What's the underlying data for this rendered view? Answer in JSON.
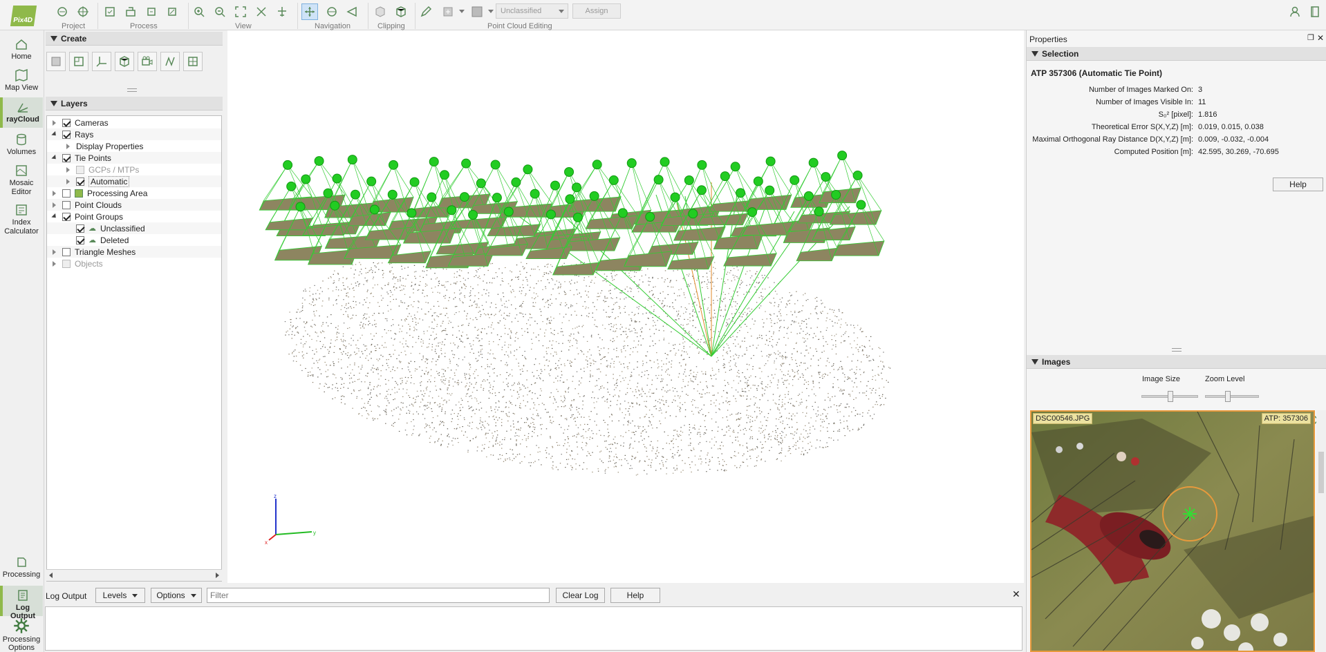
{
  "app": {
    "logo": "Pix4D"
  },
  "toolbar": {
    "groups": [
      "Project",
      "Process",
      "View",
      "Navigation",
      "Clipping",
      "Point Cloud Editing"
    ],
    "class_select": "Unclassified",
    "assign_label": "Assign"
  },
  "sidebar": {
    "home": "Home",
    "map_view": "Map View",
    "raycloud": "rayCloud",
    "volumes": "Volumes",
    "mosaic_editor": "Mosaic Editor",
    "index_calculator": "Index Calculator",
    "processing": "Processing",
    "log_output": "Log Output",
    "processing_options": "Processing Options"
  },
  "create": {
    "title": "Create"
  },
  "layers": {
    "title": "Layers",
    "items": [
      {
        "label": "Cameras",
        "checked": true,
        "expander": "closed",
        "indent": 0
      },
      {
        "label": "Rays",
        "checked": true,
        "expander": "open",
        "indent": 0
      },
      {
        "label": "Display Properties",
        "checked": null,
        "expander": "closed",
        "indent": 1
      },
      {
        "label": "Tie Points",
        "checked": true,
        "expander": "open",
        "indent": 0
      },
      {
        "label": "GCPs / MTPs",
        "checked": false,
        "expander": "closed",
        "indent": 1,
        "disabled": true
      },
      {
        "label": "Automatic",
        "checked": true,
        "expander": "closed",
        "indent": 1
      },
      {
        "label": "Processing Area",
        "checked": false,
        "expander": "closed",
        "indent": 0
      },
      {
        "label": "Point Clouds",
        "checked": false,
        "expander": "closed",
        "indent": 0
      },
      {
        "label": "Point Groups",
        "checked": true,
        "expander": "open",
        "indent": 0
      },
      {
        "label": "Unclassified",
        "checked": true,
        "expander": "none",
        "indent": 1
      },
      {
        "label": "Deleted",
        "checked": true,
        "expander": "none",
        "indent": 1
      },
      {
        "label": "Triangle Meshes",
        "checked": false,
        "expander": "closed",
        "indent": 0
      },
      {
        "label": "Objects",
        "checked": false,
        "expander": "closed",
        "indent": 0,
        "disabled": true
      }
    ]
  },
  "log": {
    "title": "Log Output",
    "levels": "Levels",
    "options": "Options",
    "filter_placeholder": "Filter",
    "clear": "Clear Log",
    "help": "Help"
  },
  "properties": {
    "title": "Properties",
    "selection_title": "Selection",
    "point_title": "ATP 357306 (Automatic Tie Point)",
    "rows": [
      {
        "label": "Number of Images Marked On:",
        "value": "3"
      },
      {
        "label": "Number of Images Visible In:",
        "value": "11"
      },
      {
        "label": "S₀² [pixel]:",
        "value": "1.816"
      },
      {
        "label": "Theoretical Error S(X,Y,Z) [m]:",
        "value": "0.019, 0.015, 0.038"
      },
      {
        "label": "Maximal Orthogonal Ray Distance D(X,Y,Z) [m]:",
        "value": "0.009, -0.032, -0.004"
      },
      {
        "label": "Computed Position [m]:",
        "value": "42.595, 30.269, -70.695"
      }
    ],
    "help": "Help"
  },
  "images": {
    "title": "Images",
    "image_size_label": "Image Size",
    "zoom_level_label": "Zoom Level",
    "image_size_level": 0.5,
    "zoom_level": 0.4,
    "image_name": "DSC00546.JPG",
    "atp_label": "ATP: 357306"
  },
  "axes": {
    "z": "z",
    "y": "y",
    "x": "x"
  },
  "colors": {
    "accent": "#8fb94a",
    "camera": "#22cc22",
    "ray_orange": "#e08a2a"
  }
}
